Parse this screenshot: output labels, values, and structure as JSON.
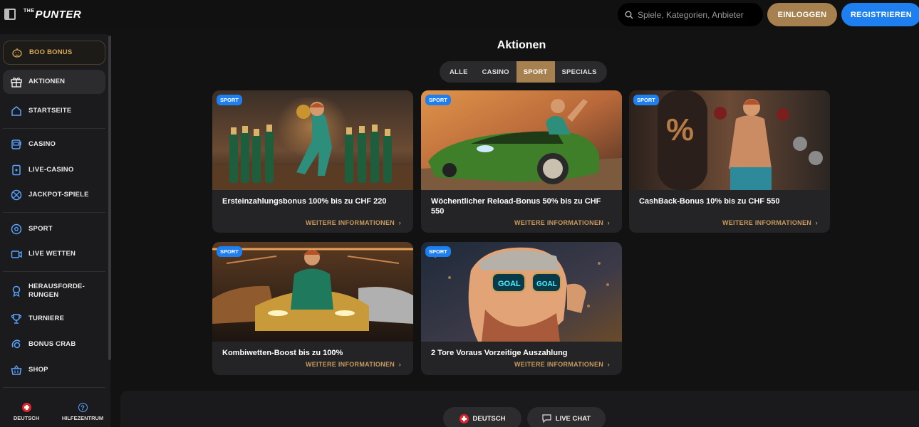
{
  "header": {
    "logo_small": "THE",
    "logo": "PUNTER",
    "search_placeholder": "Spiele, Kategorien, Anbieter",
    "login_label": "EINLOGGEN",
    "register_label": "REGISTRIEREN"
  },
  "sidebar": {
    "items": [
      {
        "label": "BOO BONUS",
        "icon": "pumpkin-icon"
      },
      {
        "label": "AKTIONEN",
        "icon": "gift-icon"
      },
      {
        "label": "STARTSEITE",
        "icon": "home-icon"
      },
      {
        "label": "CASINO",
        "icon": "slot-machine-icon"
      },
      {
        "label": "LIVE-CASINO",
        "icon": "card-icon"
      },
      {
        "label": "JACKPOT-SPIELE",
        "icon": "jackpot-icon"
      },
      {
        "label": "SPORT",
        "icon": "soccer-ball-icon"
      },
      {
        "label": "LIVE WETTEN",
        "icon": "video-icon"
      },
      {
        "label": "HERAUSFORDE-\nRUNGEN",
        "icon": "medal-icon"
      },
      {
        "label": "TURNIERE",
        "icon": "trophy-icon"
      },
      {
        "label": "BONUS CRAB",
        "icon": "crab-icon"
      },
      {
        "label": "SHOP",
        "icon": "basket-icon"
      }
    ],
    "footer": {
      "language_label": "DEUTSCH",
      "help_label": "HILFEZENTRUM"
    }
  },
  "main": {
    "title": "Aktionen",
    "tabs": [
      "ALLE",
      "CASINO",
      "SPORT",
      "SPECIALS"
    ],
    "active_tab": "SPORT",
    "cards": [
      {
        "badge": "SPORT",
        "title": "Ersteinzahlungsbonus 100% bis zu CHF 220",
        "more": "WEITERE INFORMATIONEN"
      },
      {
        "badge": "SPORT",
        "title": "Wöchentlicher Reload-Bonus 50% bis zu CHF 550",
        "more": "WEITERE INFORMATIONEN"
      },
      {
        "badge": "SPORT",
        "title": "CashBack-Bonus 10% bis zu CHF 550",
        "more": "WEITERE INFORMATIONEN"
      },
      {
        "badge": "SPORT",
        "title": "Kombiwetten-Boost bis zu 100%",
        "more": "WEITERE INFORMATIONEN"
      },
      {
        "badge": "SPORT",
        "title": "2 Tore Voraus Vorzeitige Auszahlung",
        "more": "WEITERE INFORMATIONEN"
      }
    ]
  },
  "footer": {
    "language_label": "DEUTSCH",
    "chat_label": "LIVE CHAT"
  },
  "colors": {
    "accent_gold": "#a7804f",
    "accent_blue": "#1e80f0"
  }
}
